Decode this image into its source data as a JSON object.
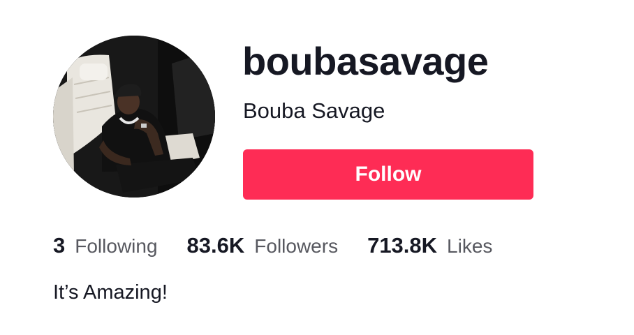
{
  "profile": {
    "username": "boubasavage",
    "nickname": "Bouba Savage",
    "follow_label": "Follow",
    "bio": "It’s Amazing!",
    "accent_color": "#fe2c55"
  },
  "stats": [
    {
      "value": "3",
      "label": "Following"
    },
    {
      "value": "83.6K",
      "label": "Followers"
    },
    {
      "value": "713.8K",
      "label": "Likes"
    }
  ]
}
